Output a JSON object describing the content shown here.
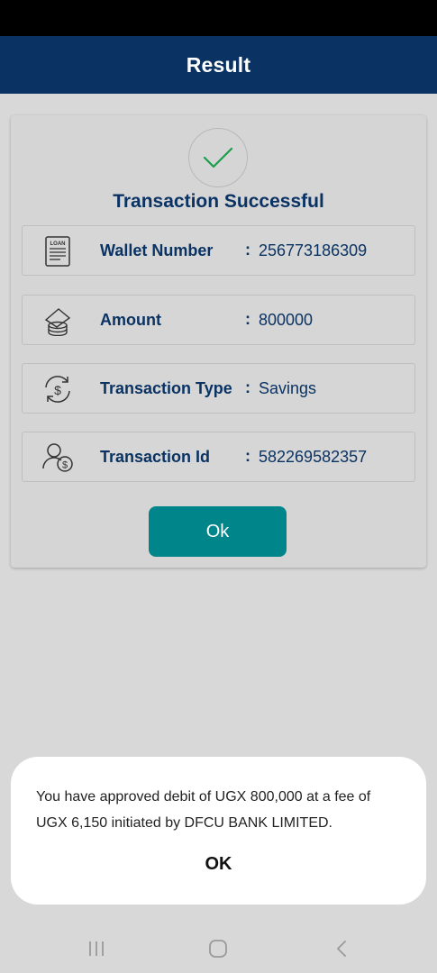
{
  "header": {
    "title": "Result"
  },
  "card": {
    "title": "Transaction Successful",
    "rows": [
      {
        "label": "Wallet Number",
        "colon": ":",
        "value": "256773186309",
        "icon": "loan-document-icon",
        "icon_text": "LOAN"
      },
      {
        "label": "Amount",
        "colon": ":",
        "value": "800000",
        "icon": "money-stack-icon"
      },
      {
        "label": "Transaction Type",
        "colon": ":",
        "value": "Savings",
        "icon": "dollar-exchange-icon"
      },
      {
        "label": "Transaction Id",
        "colon": ":",
        "value": "582269582357",
        "icon": "user-dollar-icon"
      }
    ],
    "ok_button_label": "Ok"
  },
  "toast": {
    "message": "You have approved debit of UGX 800,000 at a fee of UGX 6,150 initiated  by DFCU BANK LIMITED.",
    "ok_label": "OK"
  },
  "colors": {
    "header_bg": "#0a3363",
    "accent_teal": "#00868a",
    "text_navy": "#0a3363",
    "check_green": "#1a9e4a"
  },
  "nav": {
    "items": [
      "recent-apps-icon",
      "home-icon",
      "back-icon"
    ]
  }
}
